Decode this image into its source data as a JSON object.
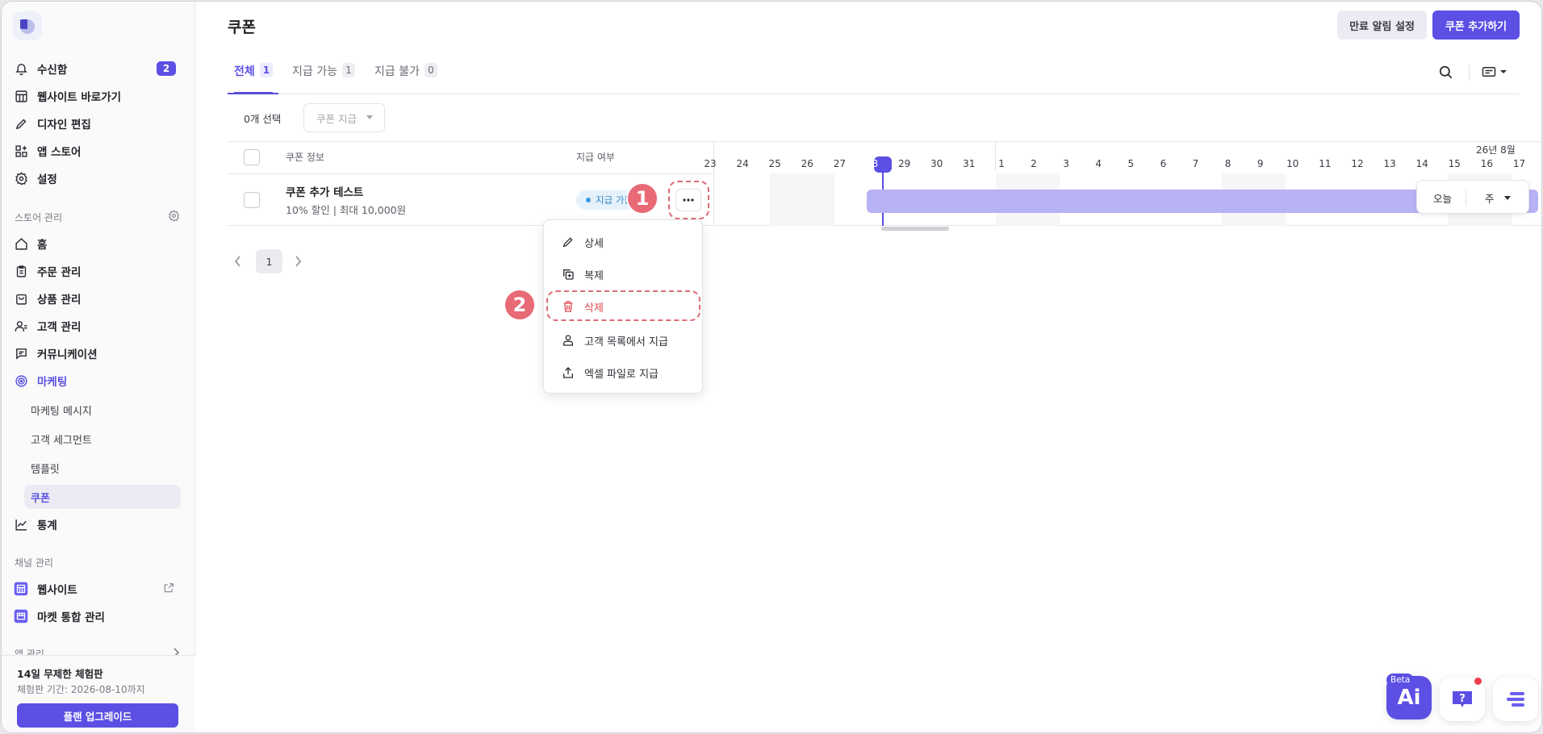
{
  "sidebar": {
    "top_items": [
      {
        "label": "수신함",
        "icon": "bell-icon",
        "badge": "2"
      },
      {
        "label": "웹사이트 바로가기",
        "icon": "building-icon"
      },
      {
        "label": "디자인 편집",
        "icon": "pen-icon"
      },
      {
        "label": "앱 스토어",
        "icon": "apps-icon"
      },
      {
        "label": "설정",
        "icon": "gear-icon"
      }
    ],
    "store_section": "스토어 관리",
    "store_items": [
      {
        "label": "홈",
        "icon": "home-icon"
      },
      {
        "label": "주문 관리",
        "icon": "clipboard-icon"
      },
      {
        "label": "상품 관리",
        "icon": "bag-icon"
      },
      {
        "label": "고객 관리",
        "icon": "users-icon"
      },
      {
        "label": "커뮤니케이션",
        "icon": "chat-icon"
      },
      {
        "label": "마케팅",
        "icon": "target-icon"
      }
    ],
    "marketing_sub": [
      "마케팅 메시지",
      "고객 세그먼트",
      "템플릿",
      "쿠폰"
    ],
    "stats_item": {
      "label": "통계",
      "icon": "chart-icon"
    },
    "channel_section": "채널 관리",
    "channel_items": [
      {
        "label": "웹사이트",
        "icon": "building-icon"
      },
      {
        "label": "마켓 통합 관리",
        "icon": "market-icon"
      }
    ],
    "app_section": "앱 관리",
    "trial": {
      "title": "14일 무제한 체험판",
      "period": "체험판 기간: 2026-08-10까지",
      "upgrade": "플랜 업그레이드"
    }
  },
  "header": {
    "title": "쿠폰",
    "expiry_btn": "만료 알림 설정",
    "add_btn": "쿠폰 추가하기"
  },
  "tabs": [
    {
      "label": "전체",
      "count": "1"
    },
    {
      "label": "지급 가능",
      "count": "1"
    },
    {
      "label": "지급 불가",
      "count": "0"
    }
  ],
  "toolbar": {
    "selected": "0개 선택",
    "issue_dropdown": "쿠폰 지급"
  },
  "table": {
    "col_info": "쿠폰 정보",
    "col_status": "지급 여부",
    "rows": [
      {
        "name": "쿠폰 추가 테스트",
        "desc": "10% 할인 | 최대 10,000원",
        "status": "지급 가능"
      }
    ]
  },
  "gantt": {
    "month_label": "26년 8월",
    "dates": [
      "23",
      "24",
      "25",
      "26",
      "27",
      "28",
      "29",
      "30",
      "31",
      "1",
      "2",
      "3",
      "4",
      "5",
      "6",
      "7",
      "8",
      "9",
      "10",
      "11",
      "12",
      "13",
      "14",
      "15",
      "16",
      "17"
    ],
    "today": "28",
    "zoom_today": "오늘",
    "zoom_unit": "주"
  },
  "pagination": {
    "current": "1"
  },
  "menu": {
    "items": [
      {
        "label": "상세",
        "icon": "pencil-icon"
      },
      {
        "label": "복제",
        "icon": "duplicate-icon"
      },
      {
        "label": "삭제",
        "icon": "trash-icon",
        "danger": true
      },
      {
        "label": "고객 목록에서 지급",
        "icon": "person-icon"
      },
      {
        "label": "엑셀 파일로 지급",
        "icon": "upload-icon"
      }
    ]
  },
  "annotations": {
    "step1": "1",
    "step2": "2"
  },
  "floating": {
    "beta": "Beta",
    "ai": "Ai"
  },
  "colors": {
    "accent": "#5b4fe4",
    "danger": "#e0464e",
    "annotation": "#e86a76"
  }
}
